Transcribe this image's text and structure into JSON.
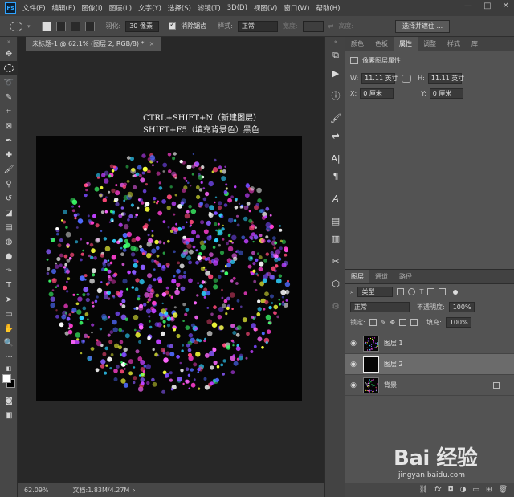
{
  "menubar": {
    "logo": "Ps",
    "items": [
      "文件(F)",
      "编辑(E)",
      "图像(I)",
      "图层(L)",
      "文字(Y)",
      "选择(S)",
      "滤镜(T)",
      "3D(D)",
      "视图(V)",
      "窗口(W)",
      "帮助(H)"
    ],
    "window_controls": [
      "—",
      "□",
      "✕"
    ]
  },
  "options": {
    "feather_label": "羽化:",
    "feather_value": "30 像素",
    "antialias_label": "消除锯齿",
    "style_label": "样式:",
    "style_value": "正常",
    "width_label": "宽度:",
    "height_label": "高度:",
    "select_mask_button": "选择并遮住 ..."
  },
  "document": {
    "tab_title": "未标题-1 @ 62.1% (图层 2, RGB/8) *",
    "tab_close": "×",
    "annotation_line1": "CTRL+SHIFT+N（新建图层）",
    "annotation_line2": "SHIFT+F5（填充背景色）黑色",
    "status_zoom": "62.09%",
    "status_doc": "文档:1.83M/4.27M"
  },
  "properties_panel": {
    "tabs": [
      "颜色",
      "色板",
      "属性",
      "调整",
      "样式",
      "库"
    ],
    "active_tab": "属性",
    "title": "像素图层属性",
    "w_label": "W:",
    "w_value": "11.11 英寸",
    "h_label": "H:",
    "h_value": "11.11 英寸",
    "x_label": "X:",
    "x_value": "0 厘米",
    "y_label": "Y:",
    "y_value": "0 厘米"
  },
  "layers_panel": {
    "tabs": [
      "图层",
      "通道",
      "路径"
    ],
    "active_tab": "图层",
    "filter_value": "类型",
    "blend_mode": "正常",
    "opacity_label": "不透明度:",
    "opacity_value": "100%",
    "lock_label": "锁定:",
    "fill_label": "填充:",
    "fill_value": "100%",
    "layers": [
      {
        "name": "图层 1",
        "selected": false,
        "locked": false
      },
      {
        "name": "图层 2",
        "selected": true,
        "locked": false
      },
      {
        "name": "背景",
        "selected": false,
        "locked": true
      }
    ],
    "footer_icons": [
      "link-icon",
      "fx-icon",
      "mask-icon",
      "adjustment-icon",
      "folder-icon",
      "new-layer-icon",
      "trash-icon"
    ]
  },
  "watermark": {
    "logo": "Bai 经验",
    "url": "jingyan.baidu.com"
  },
  "colors": {
    "menubar_bg": "#3c3c3c",
    "panel_bg": "#535353",
    "canvas_bg": "#050505",
    "workspace_bg": "#282828"
  }
}
